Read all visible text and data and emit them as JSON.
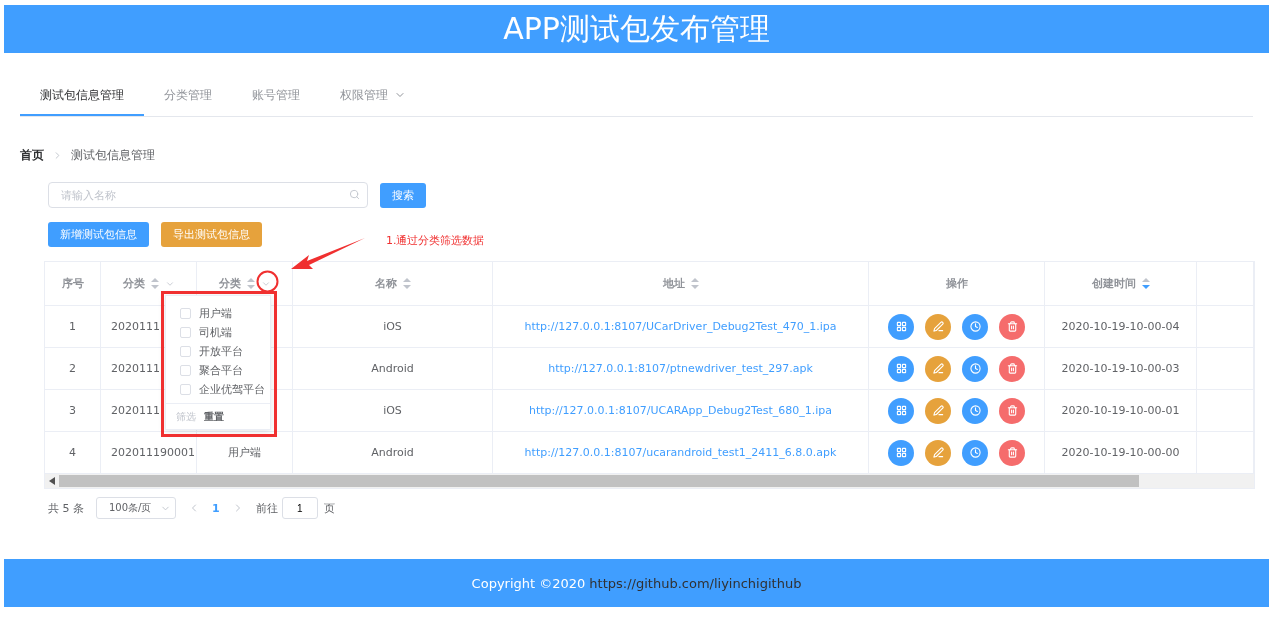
{
  "header": {
    "title": "APP测试包发布管理"
  },
  "nav": {
    "tabs": [
      {
        "label": "测试包信息管理",
        "selected": true,
        "kind": "tab"
      },
      {
        "label": "分类管理",
        "selected": false,
        "kind": "tab"
      },
      {
        "label": "账号管理",
        "selected": false,
        "kind": "tab"
      },
      {
        "label": "权限管理",
        "selected": false,
        "kind": "menu"
      }
    ]
  },
  "breadcrumb": [
    {
      "label": "首页",
      "current": false
    },
    {
      "label": "测试包信息管理",
      "current": true
    }
  ],
  "search": {
    "placeholder": "请输入名称",
    "button": "搜索"
  },
  "actions": [
    {
      "label": "新增测试包信息",
      "kind": "primary"
    },
    {
      "label": "导出测试包信息",
      "kind": "warning"
    }
  ],
  "annotation": {
    "text": "1.通过分类筛选数据"
  },
  "table": {
    "columns": [
      {
        "label": "序号",
        "sortable": false,
        "filterable": false,
        "sort_active": false
      },
      {
        "label": "分类",
        "sortable": true,
        "filterable": true,
        "sort_active": false
      },
      {
        "label": "分类",
        "sortable": true,
        "filterable": true,
        "sort_active": false
      },
      {
        "label": "名称",
        "sortable": true,
        "filterable": false,
        "sort_active": false
      },
      {
        "label": "地址",
        "sortable": true,
        "filterable": false,
        "sort_active": false
      },
      {
        "label": "操作",
        "sortable": false,
        "filterable": false,
        "sort_active": false
      },
      {
        "label": "创建时间",
        "sortable": true,
        "filterable": false,
        "sort_active": true
      }
    ],
    "rows": [
      {
        "index": "1",
        "category": "2020111",
        "name": "iOS",
        "url": "http://127.0.0.1:8107/UCarDriver_Debug2Test_470_1.ipa",
        "created": "2020-10-19-10-00-04"
      },
      {
        "index": "2",
        "category": "2020111",
        "name": "Android",
        "url": "http://127.0.0.1:8107/ptnewdriver_test_297.apk",
        "created": "2020-10-19-10-00-03"
      },
      {
        "index": "3",
        "category": "2020111",
        "name": "iOS",
        "url": "http://127.0.0.1:8107/UCARApp_Debug2Test_680_1.ipa",
        "created": "2020-10-19-10-00-01"
      },
      {
        "index": "4",
        "category": "202011190001",
        "category_2": "用户端",
        "name": "Android",
        "url": "http://127.0.0.1:8107/ucarandroid_test1_2411_6.8.0.apk",
        "created": "2020-10-19-10-00-00"
      }
    ],
    "filter_dropdown": {
      "options": [
        {
          "label": "用户端",
          "checked": false
        },
        {
          "label": "司机端",
          "checked": false
        },
        {
          "label": "开放平台",
          "checked": false
        },
        {
          "label": "聚合平台",
          "checked": false
        },
        {
          "label": "企业优驾平台",
          "checked": false
        }
      ],
      "buttons": [
        {
          "label": "筛选",
          "disabled": true
        },
        {
          "label": "重置",
          "disabled": false
        }
      ]
    }
  },
  "pagination": {
    "total": "共 5 条",
    "page_size": "100条/页",
    "pages": [
      {
        "label": "1",
        "selected": true
      }
    ],
    "goto_label": "前往",
    "goto_value": "1",
    "goto_suffix": "页"
  },
  "footer": {
    "copyright": "Copyright ©2020",
    "link": "https://github.com/liyinchigithub"
  }
}
